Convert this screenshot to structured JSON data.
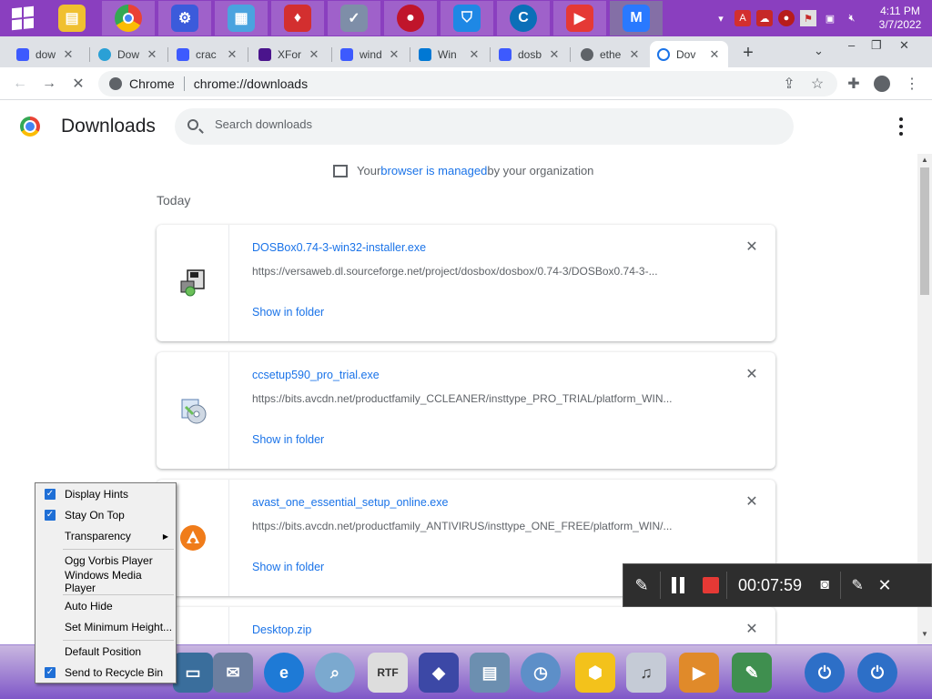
{
  "taskbar": {
    "apps": [
      {
        "icon": "file-explorer-icon",
        "color": "#f0c030"
      },
      {
        "icon": "chrome-icon",
        "color": "#4285f4"
      },
      {
        "icon": "settings-gear-icon",
        "color": "#3b5bdb"
      },
      {
        "icon": "control-panel-icon",
        "color": "#4aa3df"
      },
      {
        "icon": "shield-icon",
        "color": "#d32f2f"
      },
      {
        "icon": "security-shield-check-icon",
        "color": "#7e8ea8"
      },
      {
        "icon": "red-globe-icon",
        "color": "#c0152b"
      },
      {
        "icon": "blue-shield-icon",
        "color": "#1e88e5"
      },
      {
        "icon": "ccleaner-icon",
        "color": "#0b6fb8"
      },
      {
        "icon": "video-recorder-icon",
        "color": "#e53935"
      },
      {
        "icon": "malwarebytes-icon",
        "color": "#2979ff"
      }
    ],
    "clock": {
      "time": "4:11 PM",
      "date": "3/7/2022"
    },
    "tray_icons": [
      "chevron-up-icon",
      "acrobat-icon",
      "cloud-icon",
      "red-dot-icon",
      "flag-icon",
      "network-icon",
      "volume-muted-icon"
    ]
  },
  "browser": {
    "tabs": [
      {
        "title": "dow",
        "favicon": "vpn-favicon"
      },
      {
        "title": "Dow",
        "favicon": "edge-favicon"
      },
      {
        "title": "crac",
        "favicon": "vpn-favicon"
      },
      {
        "title": "XFor",
        "favicon": "xforce-favicon"
      },
      {
        "title": "wind",
        "favicon": "vpn-favicon"
      },
      {
        "title": "Win",
        "favicon": "windows-favicon"
      },
      {
        "title": "dosb",
        "favicon": "vpn-favicon"
      },
      {
        "title": "ethe",
        "favicon": "globe-favicon"
      },
      {
        "title": "Dov",
        "favicon": "downloads-favicon"
      }
    ],
    "omnibox": {
      "chip": "Chrome",
      "url": "chrome://downloads"
    }
  },
  "downloads": {
    "title": "Downloads",
    "search_placeholder": "Search downloads",
    "managed_prefix": "Your ",
    "managed_link": "browser is managed",
    "managed_suffix": " by your organization",
    "section": "Today",
    "items": [
      {
        "name": "DOSBox0.74-3-win32-installer.exe",
        "url": "https://versaweb.dl.sourceforge.net/project/dosbox/dosbox/0.74-3/DOSBox0.74-3-...",
        "action": "Show in folder",
        "icon": "installer-icon"
      },
      {
        "name": "ccsetup590_pro_trial.exe",
        "url": "https://bits.avcdn.net/productfamily_CCLEANER/insttype_PRO_TRIAL/platform_WIN...",
        "action": "Show in folder",
        "icon": "cd-installer-icon"
      },
      {
        "name": "avast_one_essential_setup_online.exe",
        "url": "https://bits.avcdn.net/productfamily_ANTIVIRUS/insttype_ONE_FREE/platform_WIN/...",
        "action": "Show in folder",
        "icon": "avast-icon"
      },
      {
        "name": "Desktop.zip",
        "url": "",
        "action": "",
        "icon": "zip-icon"
      }
    ]
  },
  "context_menu": {
    "items": [
      {
        "label": "Display Hints",
        "checked": true
      },
      {
        "label": "Stay On Top",
        "checked": true
      },
      {
        "label": "Transparency",
        "checked": false,
        "submenu": true
      },
      {
        "label": "Ogg Vorbis Player",
        "checked": false
      },
      {
        "label": "Windows Media Player",
        "checked": false
      },
      {
        "label": "Auto Hide",
        "checked": false
      },
      {
        "label": "Set Minimum Height...",
        "checked": false
      },
      {
        "label": "Default Position",
        "checked": false
      },
      {
        "label": "Send to Recycle Bin",
        "checked": true
      }
    ]
  },
  "recorder": {
    "time": "00:07:59"
  },
  "dock": {
    "items": [
      "computer-icon",
      "mail-icon",
      "ie-icon",
      "magnifier-icon",
      "rtf-doc-icon",
      "cube-icon",
      "drive-icon",
      "clock-folder-icon",
      "hexagon-gear-icon",
      "sound-icon",
      "media-player-icon",
      "paint-icon",
      "power-icon",
      "shutdown-icon"
    ]
  },
  "colors": {
    "taskbar": "#8a3fbf",
    "link": "#1a73e8",
    "dock_top": "#c9b7e0",
    "dock_bottom": "#7f57c8"
  }
}
